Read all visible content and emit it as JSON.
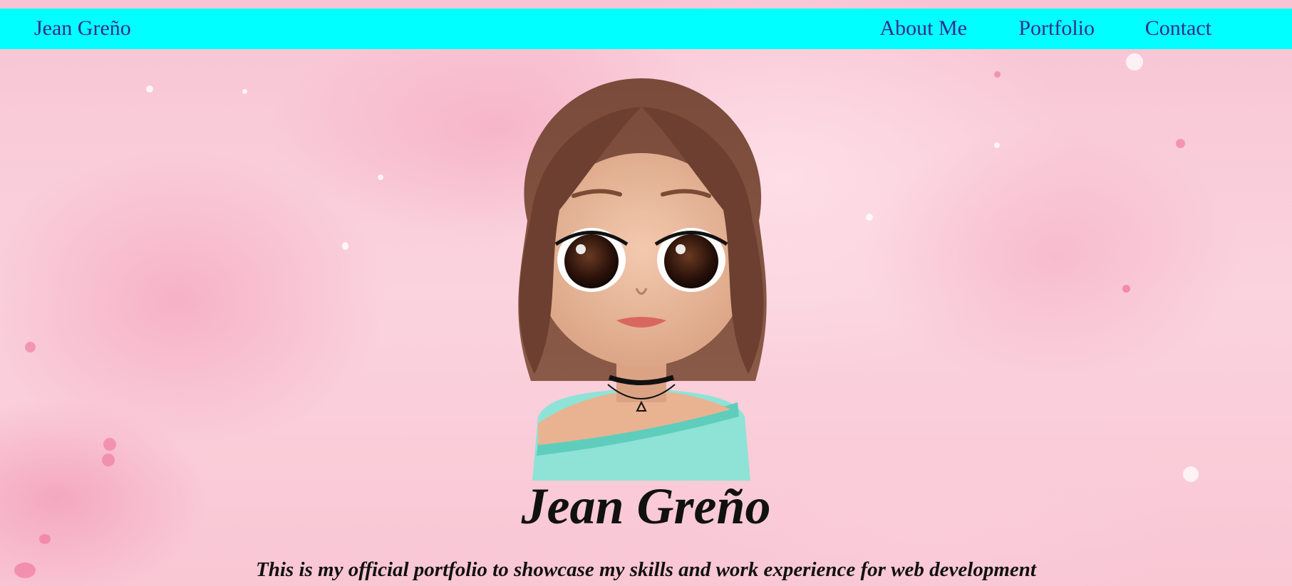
{
  "nav": {
    "brand": "Jean Greño",
    "links": [
      "About Me",
      "Portfolio",
      "Contact"
    ]
  },
  "hero": {
    "title": "Jean Greño",
    "subtitle": "This is my official portfolio to showcase my skills and work experience for web development"
  },
  "colors": {
    "navbar": "#00ffff",
    "nav_text": "#3a2a8c",
    "background": "#f9c9d6",
    "heading_text": "#111111"
  },
  "icons": {
    "avatar": "cartoon-girl-avatar"
  }
}
